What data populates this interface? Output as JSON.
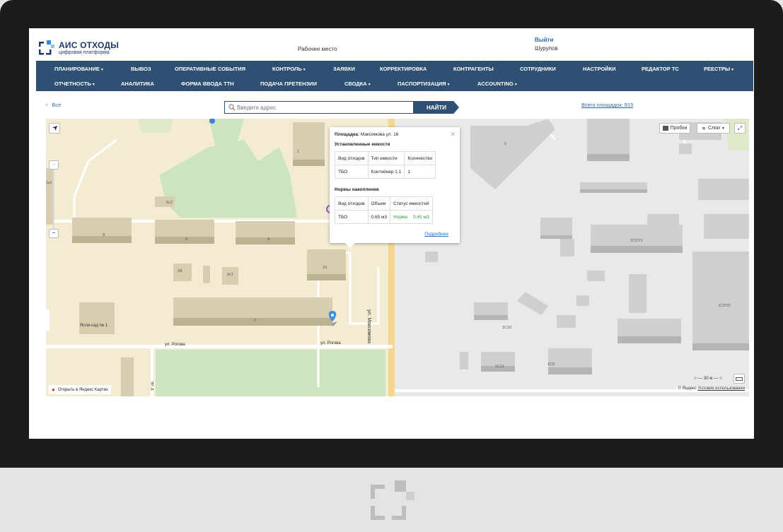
{
  "header": {
    "logo_title": "АИС ОТХОДЫ",
    "logo_subtitle": "цифровая платформа",
    "workplace_label": "Рабочее место",
    "exit_label": "Выйти",
    "user_name": "Шурупов"
  },
  "nav": {
    "row1": [
      {
        "label": "ПЛАНИРОВАНИЕ",
        "dropdown": true
      },
      {
        "label": "ВЫВОЗ",
        "dropdown": false
      },
      {
        "label": "ОПЕРАТИВНЫЕ СОБЫТИЯ",
        "dropdown": false
      },
      {
        "label": "КОНТРОЛЬ",
        "dropdown": true
      },
      {
        "label": "ЗАЯВКИ",
        "dropdown": false
      },
      {
        "label": "КОРРЕКТИРОВКА",
        "dropdown": false
      },
      {
        "label": "КОНТРАГЕНТЫ",
        "dropdown": false
      },
      {
        "label": "СОТРУДНИКИ",
        "dropdown": false
      },
      {
        "label": "НАСТРОЙКИ",
        "dropdown": false
      },
      {
        "label": "РЕДАКТОР ТС",
        "dropdown": false
      },
      {
        "label": "РЕЕСТРЫ",
        "dropdown": true
      }
    ],
    "row2": [
      {
        "label": "ОТЧЕТНОСТЬ",
        "dropdown": true
      },
      {
        "label": "АНАЛИТИКА",
        "dropdown": false
      },
      {
        "label": "ФОРМА ВВОДА ТТН",
        "dropdown": false
      },
      {
        "label": "ПОДАЧА ПРЕТЕНЗИИ",
        "dropdown": false
      },
      {
        "label": "СВОДКА",
        "dropdown": true
      },
      {
        "label": "ПАСПОРТИЗАЦИЯ",
        "dropdown": true
      },
      {
        "label": "ACCOUNTING",
        "dropdown": true
      }
    ],
    "caret": "▾"
  },
  "toolbar": {
    "all_label": "Все",
    "search_placeholder": "Введите адрес",
    "find_button": "НАЙТИ",
    "total_label": "Всего площадок: 915"
  },
  "map": {
    "traffic_button": "Пробки",
    "layers_button": "Слои",
    "zoom_in": "+",
    "zoom_out": "−",
    "streets": {
      "rogova_1": "ул. Рогова",
      "rogova_2": "ул. Рогова",
      "maksimova": "ул. Максимова",
      "side": "пр. д"
    },
    "buildings": [
      "1",
      "5",
      "6с2",
      "8",
      "6",
      "4",
      "1б",
      "2А",
      "2с1",
      "2",
      "1С37/1",
      "1С37/2",
      "1С10",
      "1С11",
      "1С9",
      "1к1"
    ],
    "kindergarten": "Ясли-сад № 1",
    "open_in_yandex": "Открыть в Яндекс Картах",
    "copyright": "© Яндекс",
    "terms": "Условия использования",
    "scale": "30 м"
  },
  "popup": {
    "site_label": "Площадка:",
    "site_value": "Максимова ул. 16",
    "installed_title": "Установленные емкости",
    "installed_headers": [
      "Вид отходов",
      "Тип емкости",
      "Количество"
    ],
    "installed_rows": [
      [
        "ТБО",
        "Контейнер 1.1",
        "1"
      ]
    ],
    "norms_title": "Нормы накопления",
    "norms_headers": [
      "Вид отходов",
      "Объем",
      "Статус емкостей"
    ],
    "norms_rows": [
      [
        "ТБО",
        "0,65 м3",
        "Норма",
        "0,45 м3"
      ]
    ],
    "more_link": "Подробнее"
  },
  "colors": {
    "nav_bg": "#2e5073",
    "link": "#2a6db5",
    "status_ok": "#2a9a2a",
    "brand_blue": "#1f3a6a"
  }
}
